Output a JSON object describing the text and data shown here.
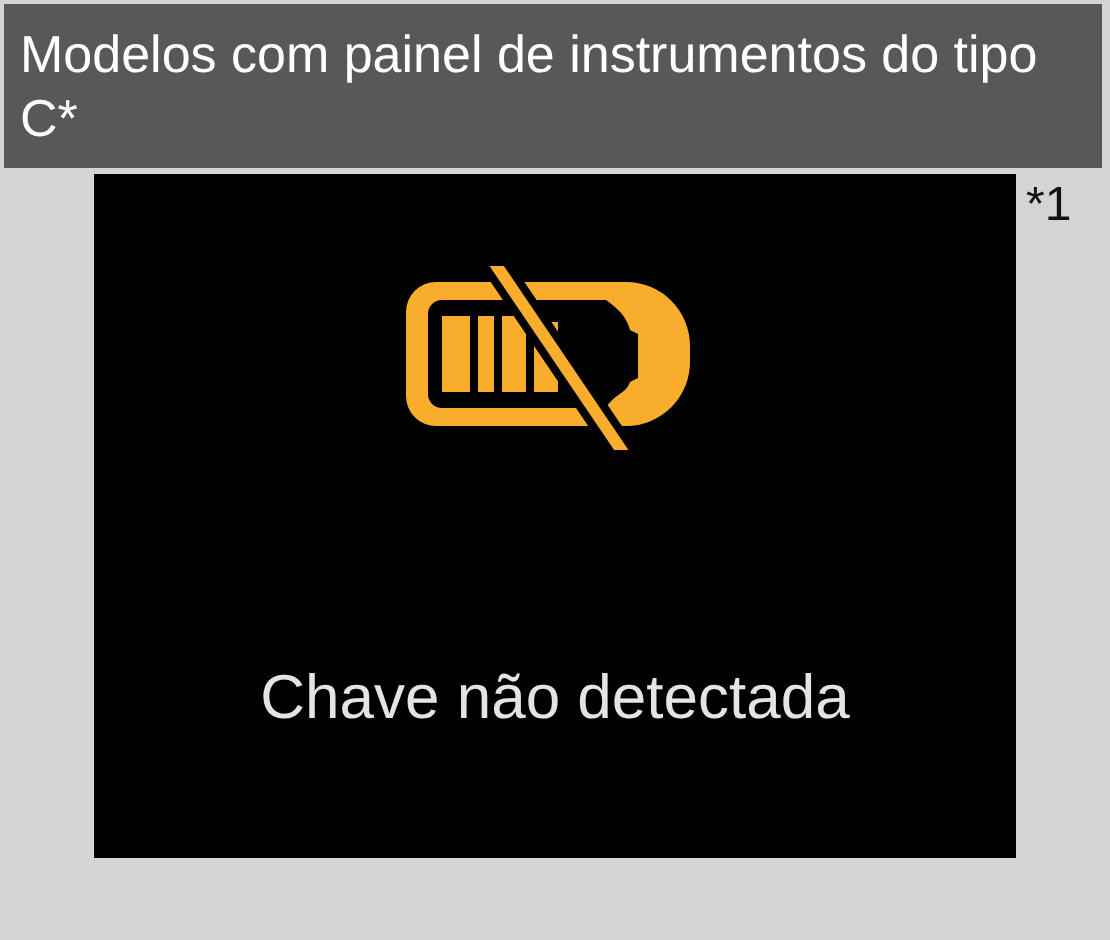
{
  "header": {
    "title": "Modelos com painel de instrumentos do tipo C*"
  },
  "footnote_mark": "*1",
  "display": {
    "message": "Chave não detectada"
  }
}
